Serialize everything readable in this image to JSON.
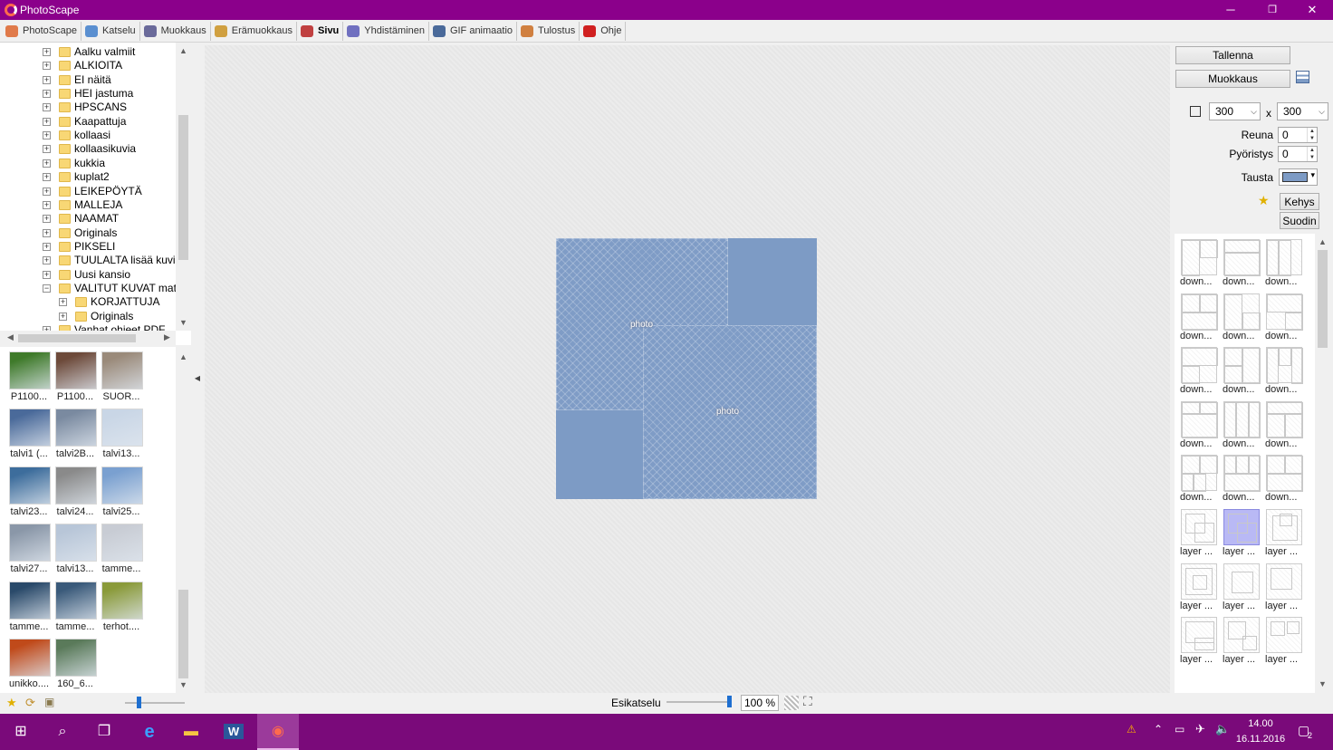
{
  "window": {
    "title": "PhotoScape",
    "controls": {
      "minimize": "─",
      "maximize": "❐",
      "close": "✕"
    }
  },
  "tabs": [
    {
      "label": "PhotoScape",
      "icon": "photoscape-icon",
      "color": "#e07a4a"
    },
    {
      "label": "Katselu",
      "icon": "viewer-icon",
      "color": "#5a8fd0"
    },
    {
      "label": "Muokkaus",
      "icon": "editor-icon",
      "color": "#6a6a9a"
    },
    {
      "label": "Erämuokkaus",
      "icon": "batch-editor-icon",
      "color": "#d0a040"
    },
    {
      "label": "Sivu",
      "icon": "page-icon",
      "color": "#c04040",
      "active": true
    },
    {
      "label": "Yhdistäminen",
      "icon": "combine-icon",
      "color": "#7070c0"
    },
    {
      "label": "GIF animaatio",
      "icon": "gif-icon",
      "color": "#4a6a9a"
    },
    {
      "label": "Tulostus",
      "icon": "print-icon",
      "color": "#d08040"
    },
    {
      "label": "Ohje",
      "icon": "help-icon",
      "color": "#d02020"
    }
  ],
  "tree": [
    {
      "label": "Aalku valmiit",
      "level": 1
    },
    {
      "label": "ALKIOITA",
      "level": 1
    },
    {
      "label": "EI näitä",
      "level": 1
    },
    {
      "label": "HEI jastuma",
      "level": 1
    },
    {
      "label": "HPSCANS",
      "level": 1
    },
    {
      "label": "Kaapattuja",
      "level": 1
    },
    {
      "label": "kollaasi",
      "level": 1
    },
    {
      "label": "kollaasikuvia",
      "level": 1
    },
    {
      "label": "kukkia",
      "level": 1
    },
    {
      "label": "kuplat2",
      "level": 1
    },
    {
      "label": "LEIKEPÖYTÄ",
      "level": 1
    },
    {
      "label": "MALLEJA",
      "level": 1
    },
    {
      "label": "NAAMAT",
      "level": 1
    },
    {
      "label": "Originals",
      "level": 1
    },
    {
      "label": "PIKSELI",
      "level": 1
    },
    {
      "label": "TUULALTA lisää kuvia",
      "level": 1
    },
    {
      "label": "Uusi kansio",
      "level": 1
    },
    {
      "label": "VALITUT KUVAT mat",
      "level": 1,
      "expanded": true
    },
    {
      "label": "KORJATTUJA",
      "level": 2
    },
    {
      "label": "Originals",
      "level": 2
    },
    {
      "label": "Vanhat ohjeet PDF",
      "level": 1
    }
  ],
  "thumbnails": [
    {
      "caption": "P1100...",
      "color": "#3f7a2a"
    },
    {
      "caption": "P1100...",
      "color": "#6d4a3a"
    },
    {
      "caption": "SUOR...",
      "color": "#9a8a7a"
    },
    {
      "caption": "talvi1 (...",
      "color": "#4a6a9a"
    },
    {
      "caption": "talvi2B...",
      "color": "#7a8aa0"
    },
    {
      "caption": "talvi13...",
      "color": "#c9d6e6"
    },
    {
      "caption": "talvi23...",
      "color": "#3d6d9c"
    },
    {
      "caption": "talvi24...",
      "color": "#8a8a8a"
    },
    {
      "caption": "talvi25...",
      "color": "#7aa0d0"
    },
    {
      "caption": "talvi27...",
      "color": "#8a97a8"
    },
    {
      "caption": "talvi13...",
      "color": "#b8c6d8"
    },
    {
      "caption": "tamme...",
      "color": "#c8ccd4"
    },
    {
      "caption": "tamme...",
      "color": "#2a4a6a"
    },
    {
      "caption": "tamme...",
      "color": "#3a5a7a"
    },
    {
      "caption": "terhot....",
      "color": "#8a9a3a"
    },
    {
      "caption": "unikko....",
      "color": "#c04a1a"
    },
    {
      "caption": "160_6...",
      "color": "#5a7a5a"
    }
  ],
  "canvas": {
    "background_color": "#7d9bc5",
    "photo_label": "photo"
  },
  "bottom": {
    "preview_label": "Esikatselu",
    "zoom_value": "100 %"
  },
  "right": {
    "save_label": "Tallenna",
    "edit_label": "Muokkaus",
    "width_value": "300",
    "size_separator": "x",
    "height_value": "300",
    "border_label": "Reuna",
    "border_value": "0",
    "rounding_label": "Pyöristys",
    "rounding_value": "0",
    "background_label": "Tausta",
    "background_color": "#7d9bc5",
    "frame_label": "Kehys",
    "filter_label": "Suodin"
  },
  "templates": [
    {
      "caption": "down..."
    },
    {
      "caption": "down..."
    },
    {
      "caption": "down..."
    },
    {
      "caption": "down..."
    },
    {
      "caption": "down..."
    },
    {
      "caption": "down..."
    },
    {
      "caption": "down..."
    },
    {
      "caption": "down..."
    },
    {
      "caption": "down..."
    },
    {
      "caption": "down..."
    },
    {
      "caption": "down..."
    },
    {
      "caption": "down..."
    },
    {
      "caption": "down..."
    },
    {
      "caption": "down..."
    },
    {
      "caption": "down..."
    },
    {
      "caption": "layer ...",
      "selected": false
    },
    {
      "caption": "layer ...",
      "selected": true
    },
    {
      "caption": "layer ..."
    },
    {
      "caption": "layer ..."
    },
    {
      "caption": "layer ..."
    },
    {
      "caption": "layer ..."
    },
    {
      "caption": "layer ..."
    },
    {
      "caption": "layer ..."
    },
    {
      "caption": "layer ..."
    }
  ],
  "taskbar": {
    "time": "14.00",
    "date": "16.11.2016",
    "notification_count": "2"
  }
}
